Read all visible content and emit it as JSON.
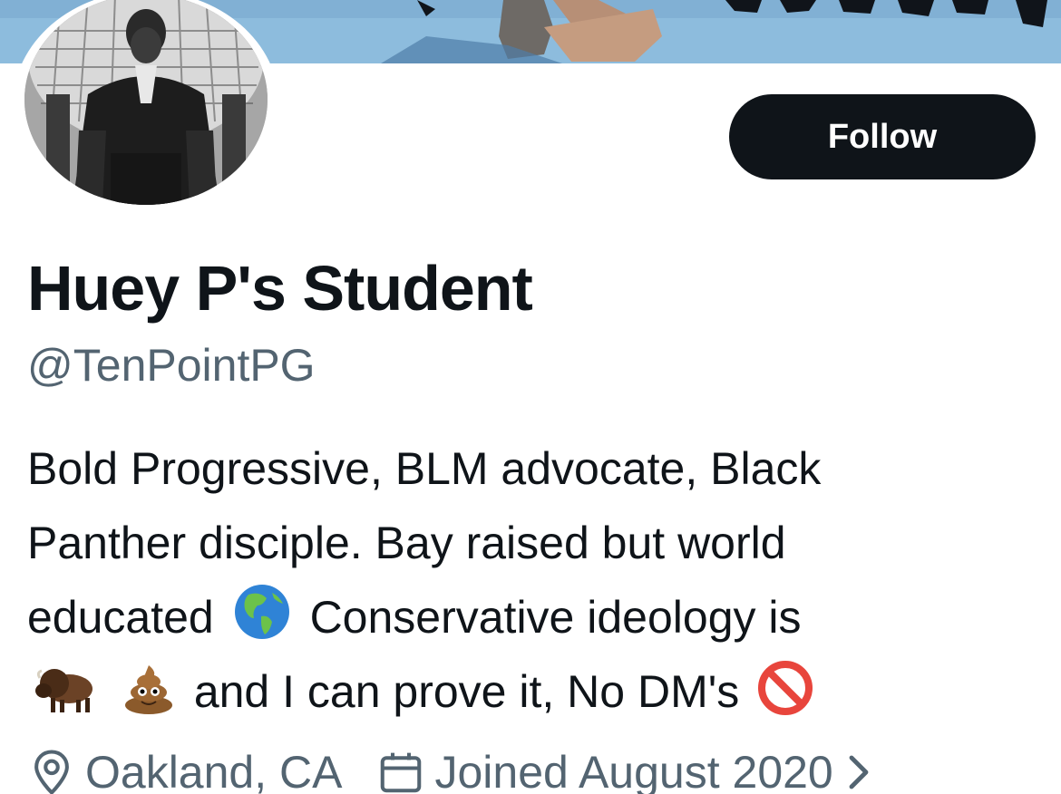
{
  "profile": {
    "display_name": "Huey P's Student",
    "handle": "@TenPointPG",
    "follow_label": "Follow",
    "bio": {
      "line1": "Bold Progressive, BLM advocate, Black",
      "line2": "Panther disciple. Bay raised but world",
      "line3_a": "educated",
      "line3_b": "Conservative ideology is",
      "line4": "and I can prove it, No DM's"
    },
    "location": "Oakland, CA",
    "joined": "Joined August 2020"
  },
  "icons": {
    "globe": "globe-americas-emoji",
    "bison": "bison-emoji",
    "poop": "pile-of-poo-emoji",
    "prohibited": "prohibited-emoji",
    "location": "location-pin-icon",
    "calendar": "calendar-icon",
    "chevron": "chevron-right-icon"
  },
  "colors": {
    "text_primary": "#0f1419",
    "text_secondary": "#536471",
    "button_bg": "#0f1419",
    "button_text": "#ffffff"
  }
}
